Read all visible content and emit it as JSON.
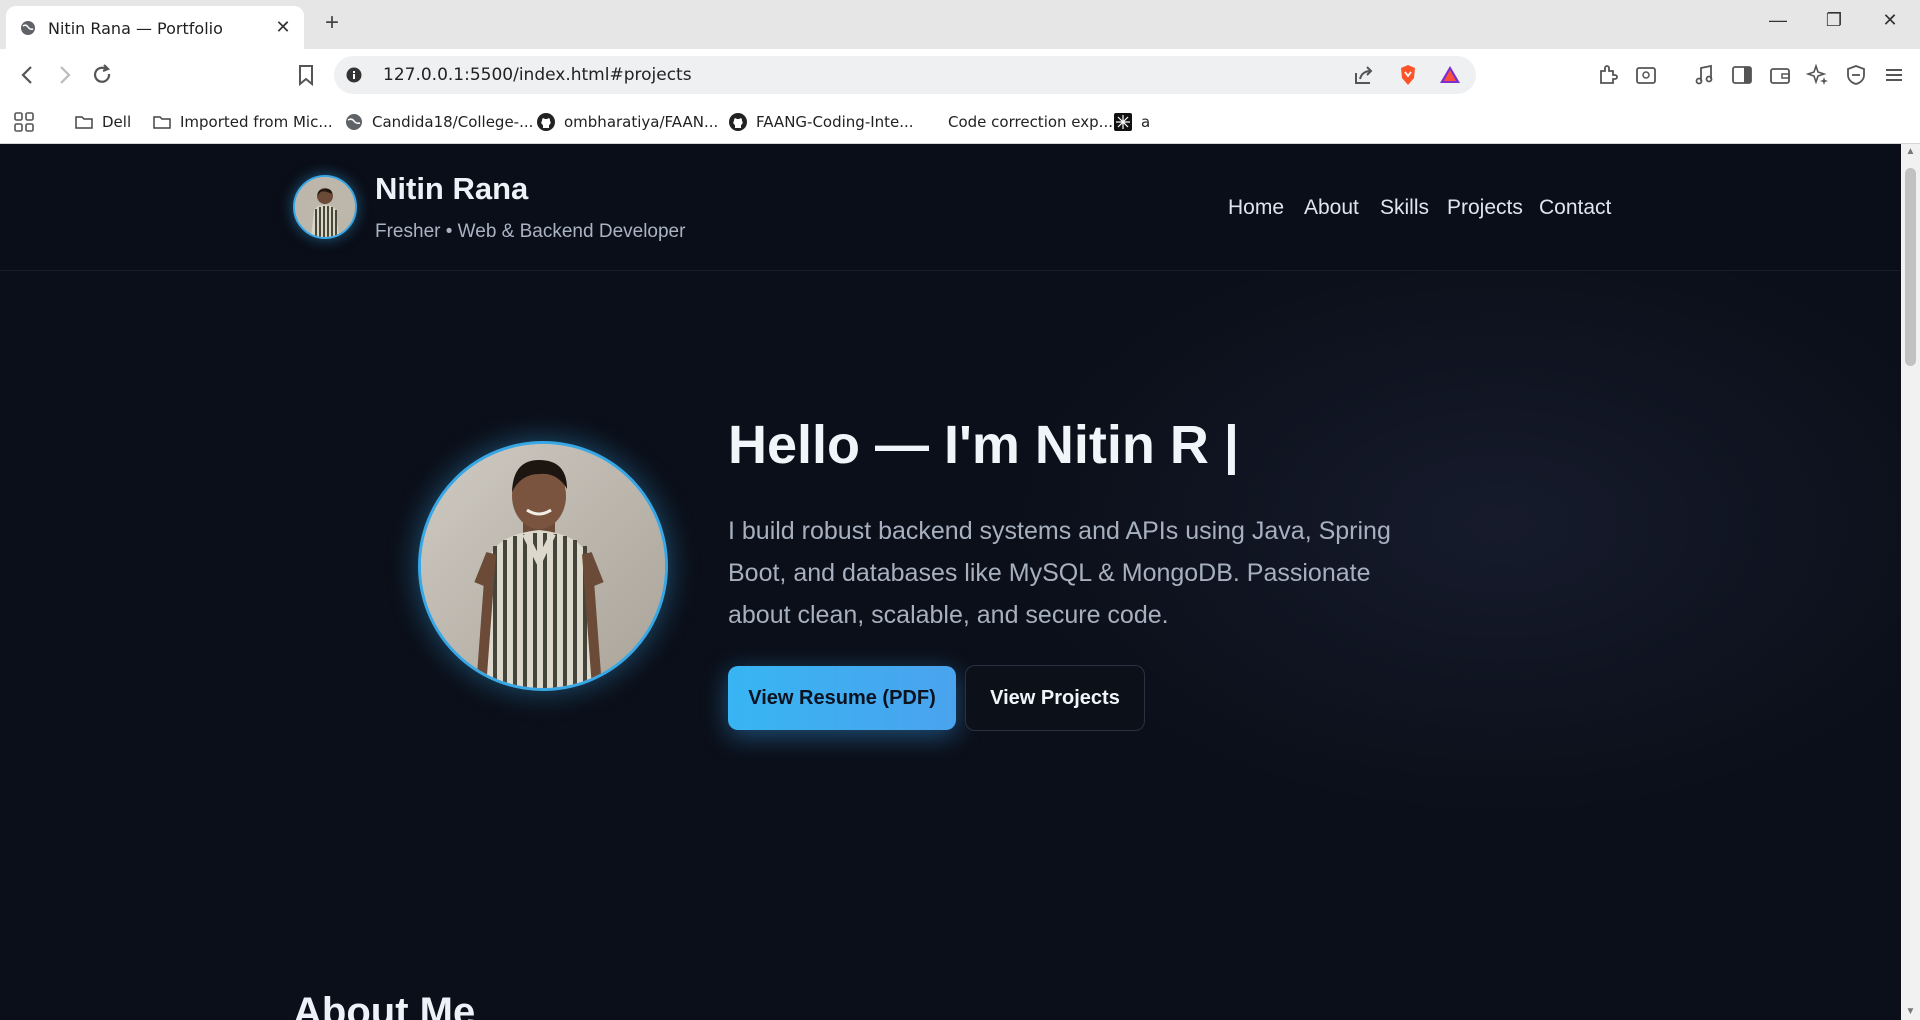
{
  "browser": {
    "tab_title": "Nitin Rana — Portfolio",
    "close_tab": "✕",
    "new_tab": "+",
    "url": "127.0.0.1:5500/index.html#projects",
    "window": {
      "minimize": "—",
      "maximize": "❐",
      "close": "✕"
    }
  },
  "bookmarks": [
    {
      "label": "Dell",
      "icon": "folder-icon"
    },
    {
      "label": "Imported from Mic...",
      "icon": "folder-icon"
    },
    {
      "label": "Candida18/College-...",
      "icon": "globe-icon"
    },
    {
      "label": "ombharatiya/FAAN...",
      "icon": "github-icon"
    },
    {
      "label": "FAANG-Coding-Inte...",
      "icon": "github-icon"
    },
    {
      "label": "Code correction exp...",
      "icon": "blank-icon"
    },
    {
      "label": "a",
      "icon": "app-icon"
    }
  ],
  "site": {
    "brand_name": "Nitin Rana",
    "brand_tagline": "Fresher • Web & Backend Developer",
    "nav": [
      "Home",
      "About",
      "Skills",
      "Projects",
      "Contact"
    ]
  },
  "hero": {
    "title": "Hello — I'm Nitin R |",
    "description": "I build robust backend systems and APIs using Java, Spring Boot, and databases like MySQL & MongoDB. Passionate about clean, scalable, and secure code.",
    "primary_button": "View Resume (PDF)",
    "secondary_button": "View Projects"
  },
  "about": {
    "title": "About Me"
  },
  "colors": {
    "accent": "#38a7e6",
    "background": "#0b0f19",
    "button_primary": "#3fb0f0"
  }
}
